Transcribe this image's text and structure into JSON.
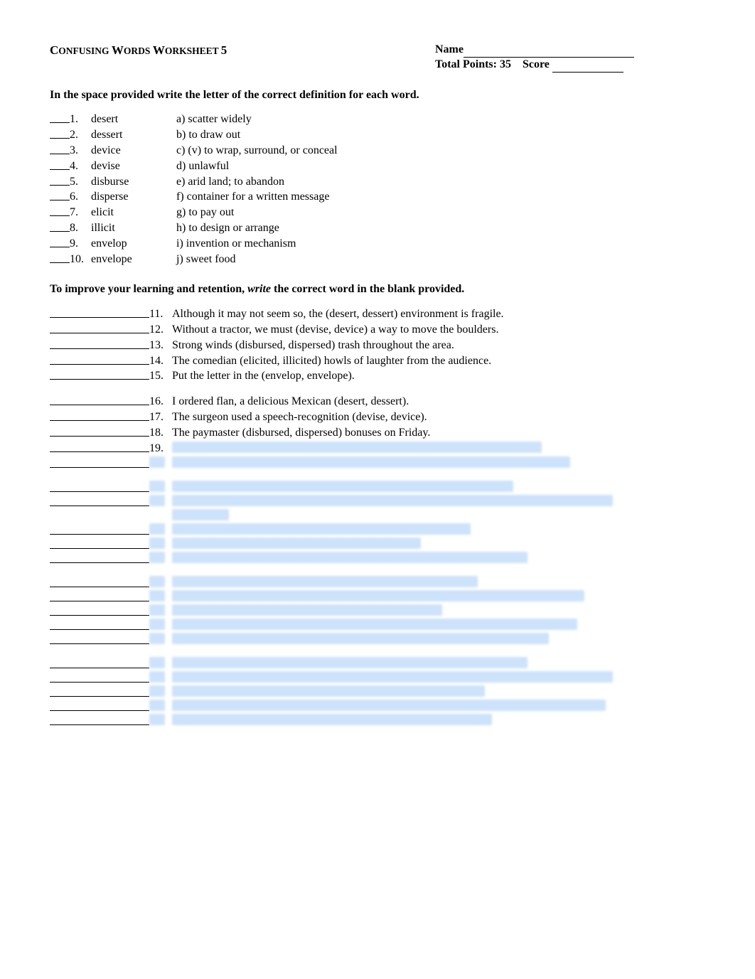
{
  "header": {
    "title_prefix_big": "C",
    "title_word1": "ONFUSING ",
    "title_big2": "W",
    "title_word2": "ORDS ",
    "title_big3": "W",
    "title_word3": "ORKSHEET ",
    "title_num": "5",
    "name_label": "Name",
    "points_label": "Total Points: 35",
    "score_label": "Score "
  },
  "instructions1": "In the space provided write the letter of the correct definition for each word.",
  "matching": [
    {
      "num": "1.",
      "word": "desert",
      "def": "a) scatter widely"
    },
    {
      "num": "2.",
      "word": "dessert",
      "def": "b) to draw out"
    },
    {
      "num": "3.",
      "word": "device",
      "def": "c) (v) to wrap, surround, or conceal"
    },
    {
      "num": "4.",
      "word": "devise",
      "def": "d) unlawful"
    },
    {
      "num": "5.",
      "word": "disburse",
      "def": "e) arid land; to abandon"
    },
    {
      "num": "6.",
      "word": "disperse",
      "def": "f) container for a written message"
    },
    {
      "num": "7.",
      "word": "elicit",
      "def": "g) to pay out"
    },
    {
      "num": "8.",
      "word": "illicit",
      "def": "h) to design or arrange"
    },
    {
      "num": "9.",
      "word": "envelop",
      "def": "i)  invention or mechanism"
    },
    {
      "num": "10.",
      "word": "envelope",
      "def": "j)  sweet food"
    }
  ],
  "instructions2_pre": "To improve your learning and retention,  ",
  "instructions2_ital": "write",
  "instructions2_post": " the correct word in the blank provided.",
  "questions_g1": [
    {
      "num": "11.",
      "text": "Although it may not seem so, the (desert, dessert) environment is fragile."
    },
    {
      "num": "12.",
      "text": "Without a tractor, we must (devise, device) a way to move the boulders."
    },
    {
      "num": "13.",
      "text": "Strong winds (disbursed, dispersed) trash throughout the area."
    },
    {
      "num": "14.",
      "text": "The comedian (elicited, illicited) howls of laughter from the audience."
    },
    {
      "num": "15.",
      "text": "Put the letter in the (envelop, envelope)."
    }
  ],
  "questions_g2": [
    {
      "num": "16.",
      "text": "I ordered flan, a delicious Mexican (desert, dessert)."
    },
    {
      "num": "17.",
      "text": "The surgeon used a speech-recognition (devise, device)."
    },
    {
      "num": "18.",
      "text": "The paymaster (disbursed, dispersed) bonuses on Friday."
    },
    {
      "num": "19.",
      "text": ""
    }
  ]
}
